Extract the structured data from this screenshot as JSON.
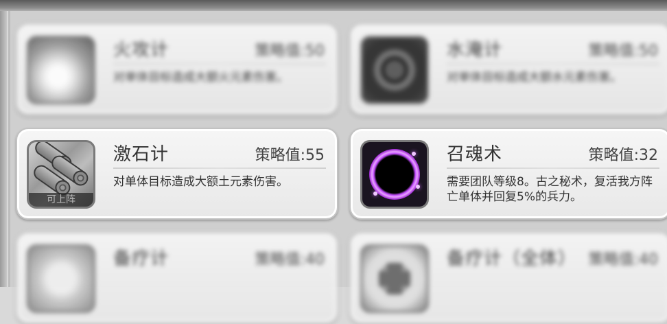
{
  "skills": [
    {
      "name": "火攻计",
      "cost": "策略值:50",
      "desc": "对单体目标造成大额火元素伤害。",
      "icon": "fire-icon"
    },
    {
      "name": "水淹计",
      "cost": "策略值:50",
      "desc": "对单体目标造成大额水元素伤害。",
      "icon": "water-swirl-icon"
    },
    {
      "name": "激石计",
      "cost": "策略值:55",
      "desc": "对单体目标造成大额土元素伤害。",
      "icon": "rolling-logs-icon",
      "icon_caption": "可上阵"
    },
    {
      "name": "召魂术",
      "cost": "策略值:32",
      "desc": "需要团队等级8。古之秘术，复活我方阵亡单体并回复5%的兵力。",
      "icon": "soul-portal-icon"
    },
    {
      "name": "备疗计",
      "cost": "策略值:40",
      "desc": "",
      "icon": "heal-icon"
    },
    {
      "name": "备疗计（全体）",
      "cost": "策略值:40",
      "desc": "",
      "icon": "heal-all-icon"
    }
  ],
  "colors": {
    "portal": "#c44dff",
    "card_bg": "#f2f2f2"
  }
}
